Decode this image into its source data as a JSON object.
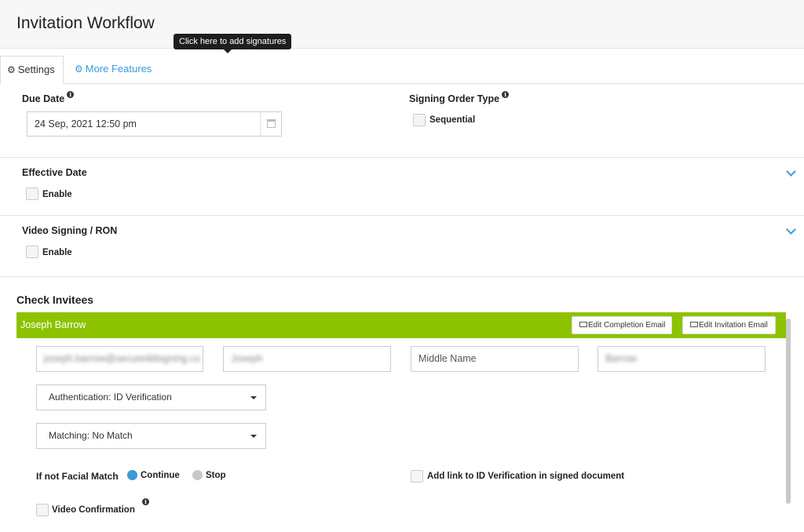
{
  "header": {
    "title": "Invitation Workflow"
  },
  "tooltip": {
    "text": "Click here to add signatures"
  },
  "tabs": [
    {
      "label": "Settings",
      "icon": "gear-icon"
    },
    {
      "label": "More Features",
      "icon": "gears-icon"
    }
  ],
  "due_date": {
    "label": "Due Date",
    "value": "24 Sep, 2021 12:50 pm"
  },
  "signing_order": {
    "label": "Signing Order Type",
    "option_label": "Sequential",
    "checked": false
  },
  "effective_date": {
    "label": "Effective Date",
    "enable_label": "Enable",
    "checked": false
  },
  "video_signing": {
    "label": "Video Signing / RON",
    "enable_label": "Enable",
    "checked": false
  },
  "check_invitees": {
    "title": "Check Invitees",
    "invitee": {
      "name": "Joseph Barrow",
      "edit_completion_label": "Edit Completion Email",
      "edit_invitation_label": "Edit Invitation Email",
      "email_value": "joseph.barrow@secureddsigning.co",
      "first_name_value": "Joseph",
      "middle_name_placeholder": "Middle Name",
      "last_name_value": "Barrow",
      "authentication_value": "Authentication: ID Verification",
      "matching_value": "Matching: No Match",
      "facial_match_label": "If not Facial Match",
      "continue_label": "Continue",
      "stop_label": "Stop",
      "facial_match_selected": "Continue",
      "add_link_label": "Add link to ID Verification in signed document",
      "video_confirmation_label": "Video Confirmation"
    }
  },
  "colors": {
    "accent_blue": "#3a9ad9",
    "invitee_bar": "#8dc200"
  }
}
